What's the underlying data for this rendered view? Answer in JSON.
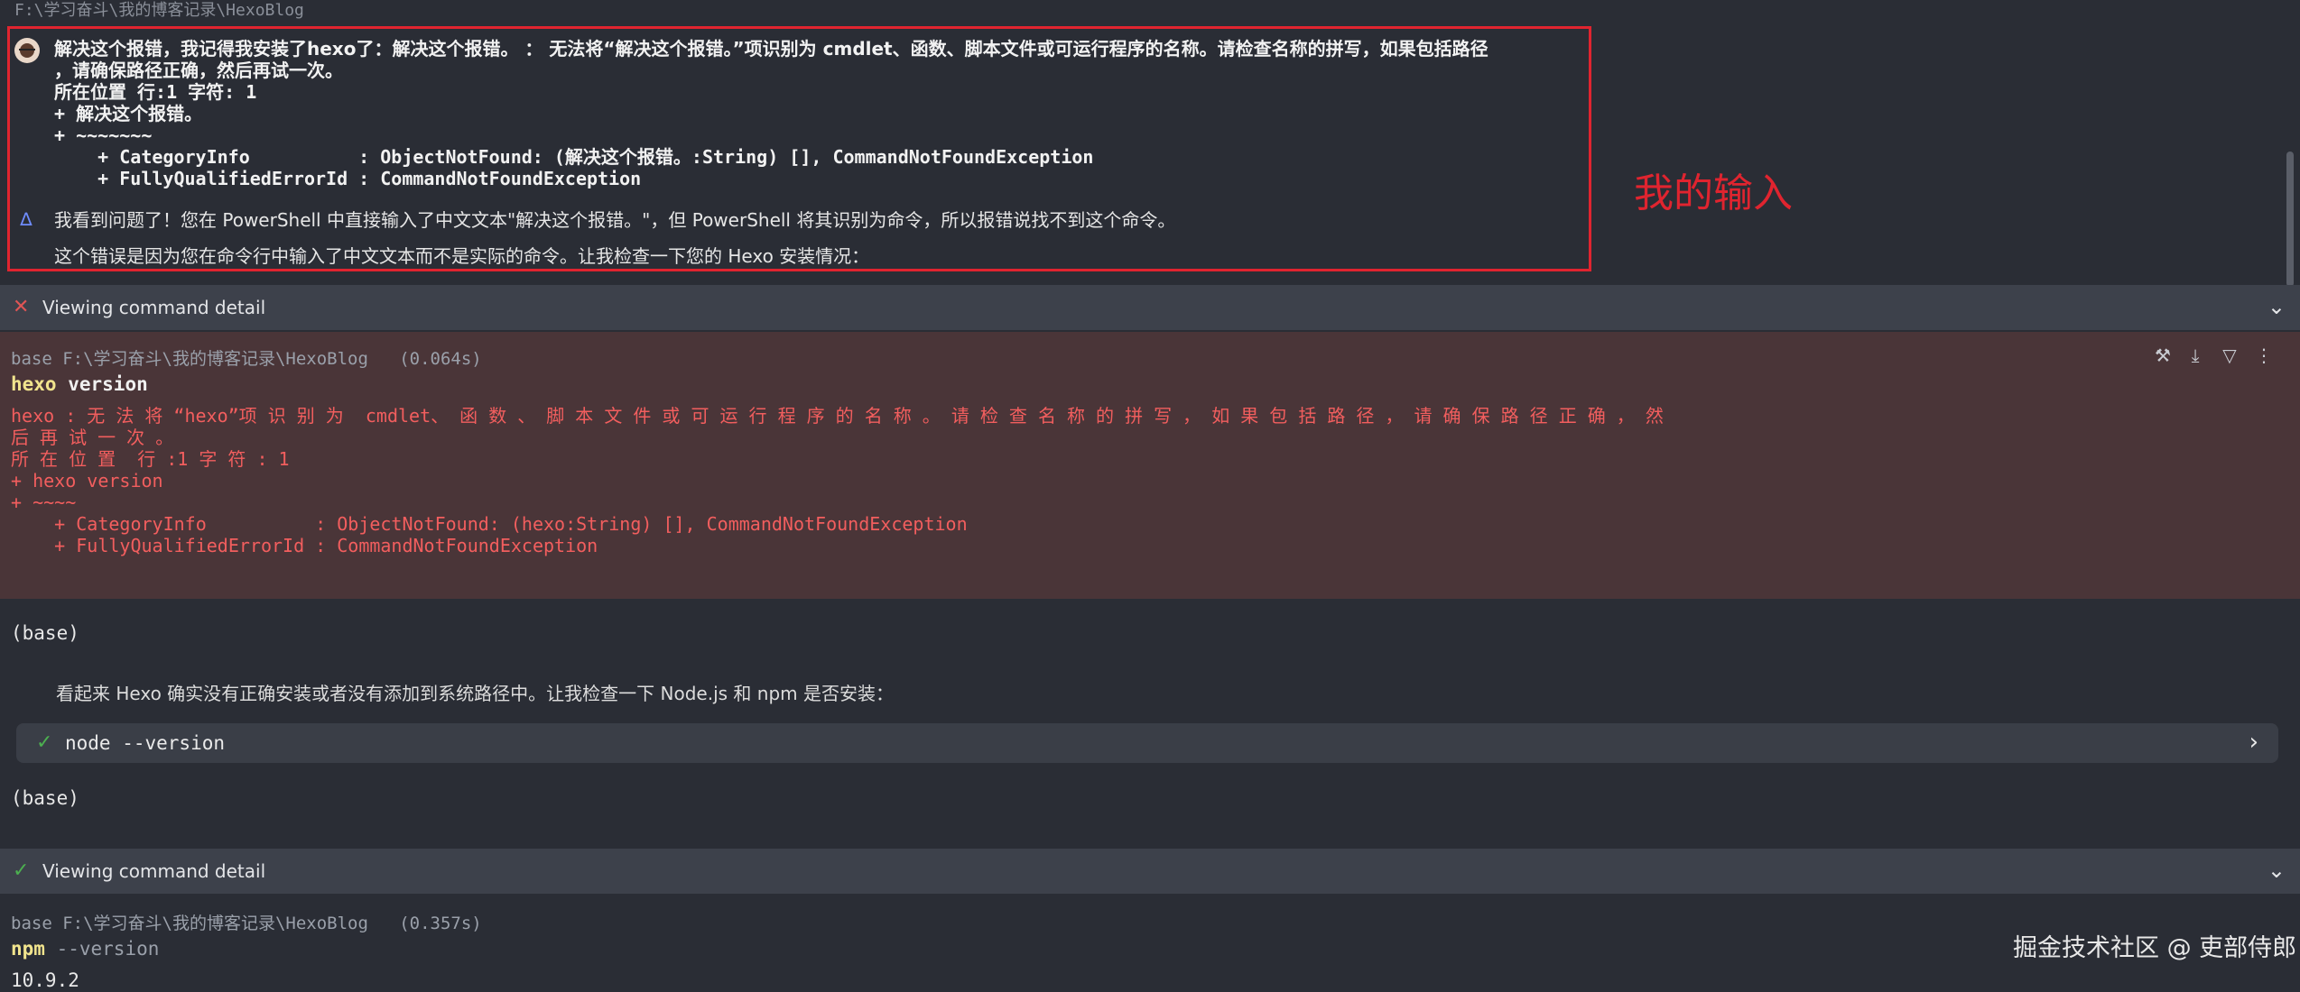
{
  "path_line": "F:\\学习奋斗\\我的博客记录\\HexoBlog",
  "user_message": {
    "lines": [
      "解决这个报错，我记得我安装了hexo了：解决这个报错。 ： 无法将“解决这个报错。”项识别为 cmdlet、函数、脚本文件或可运行程序的名称。请检查名称的拼写，如果包括路径",
      "，请确保路径正确，然后再试一次。",
      "所在位置 行:1 字符: 1",
      "+ 解决这个报错。",
      "+ ~~~~~~~",
      "    + CategoryInfo          : ObjectNotFound: (解决这个报错。:String) [], CommandNotFoundException",
      "    + FullyQualifiedErrorId : CommandNotFoundException"
    ]
  },
  "assistant_reply": {
    "line1": "我看到问题了！您在 PowerShell 中直接输入了中文文本\"解决这个报错。\"，但 PowerShell 将其识别为命令，所以报错说找不到这个命令。",
    "line2": "这个错误是因为您在命令行中输入了中文文本而不是实际的命令。让我检查一下您的 Hexo 安装情况："
  },
  "annotation_label": "我的输入",
  "detail_bar_1": {
    "title": "Viewing command detail",
    "status": "error"
  },
  "command_1": {
    "meta": "base F:\\学习奋斗\\我的博客记录\\HexoBlog   (0.064s)",
    "cmd": "hexo",
    "arg": "version",
    "error_lines": [
      "hexo : 无 法 将 “hexo”项 识 别 为  cmdlet、 函 数 、 脚 本 文 件 或 可 运 行 程 序 的 名 称 。 请 检 查 名 称 的 拼 写 ， 如 果 包 括 路 径 ， 请 确 保 路 径 正 确 ， 然",
      "后 再 试 一 次 。",
      "所 在 位 置  行 :1 字 符 : 1",
      "+ hexo version",
      "+ ~~~~",
      "    + CategoryInfo          : ObjectNotFound: (hexo:String) [], CommandNotFoundException",
      "    + FullyQualifiedErrorId : CommandNotFoundException"
    ]
  },
  "base_label_1": "(base)",
  "assistant_reply_2": "看起来 Hexo 确实没有正确安装或者没有添加到系统路径中。让我检查一下 Node.js 和 npm 是否安装：",
  "node_row": {
    "label": "node --version",
    "status": "success"
  },
  "base_label_2": "(base)",
  "detail_bar_2": {
    "title": "Viewing command detail",
    "status": "success"
  },
  "command_2": {
    "meta": "base F:\\学习奋斗\\我的博客记录\\HexoBlog   (0.357s)",
    "cmd": "npm",
    "arg": "--version",
    "result": "10.9.2"
  },
  "watermark": "掘金技术社区 @ 吏部侍郎",
  "colors": {
    "error_red": "#e0242f",
    "success_green": "#4caf50",
    "accent_blue": "#6f8cff"
  }
}
